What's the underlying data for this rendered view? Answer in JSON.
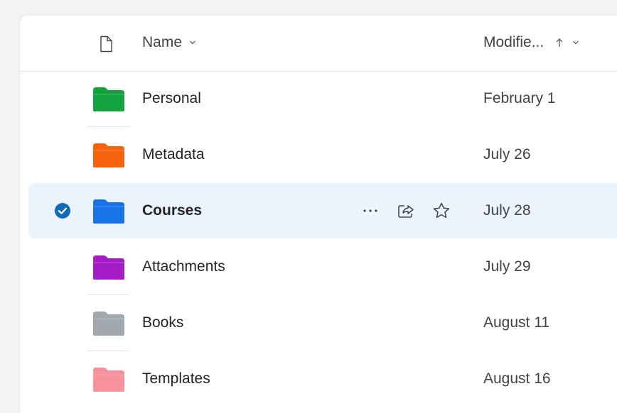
{
  "header": {
    "name_label": "Name",
    "modified_label": "Modifie..."
  },
  "rows": [
    {
      "name": "Personal",
      "modified": "February 1",
      "folder_color": "#13a33e"
    },
    {
      "name": "Metadata",
      "modified": "July 26",
      "folder_color": "#f7630c"
    },
    {
      "name": "Courses",
      "modified": "July 28",
      "folder_color": "#1773e6",
      "selected": true
    },
    {
      "name": "Attachments",
      "modified": "July 29",
      "folder_color": "#a41dc4"
    },
    {
      "name": "Books",
      "modified": "August 11",
      "folder_color": "#a1a8ae"
    },
    {
      "name": "Templates",
      "modified": "August 16",
      "folder_color": "#f7919c"
    }
  ],
  "colors": {
    "accent": "#0f6cbd",
    "selected_row_bg": "#ebf3fc"
  },
  "icons": {
    "header_file": "file-icon",
    "sort_direction": "arrow-up-icon",
    "column_menu": "chevron-down-icon",
    "row_selected": "checkmark-circle-icon",
    "row_more": "more-horizontal-icon",
    "row_share": "share-icon",
    "row_favorite": "star-icon"
  }
}
